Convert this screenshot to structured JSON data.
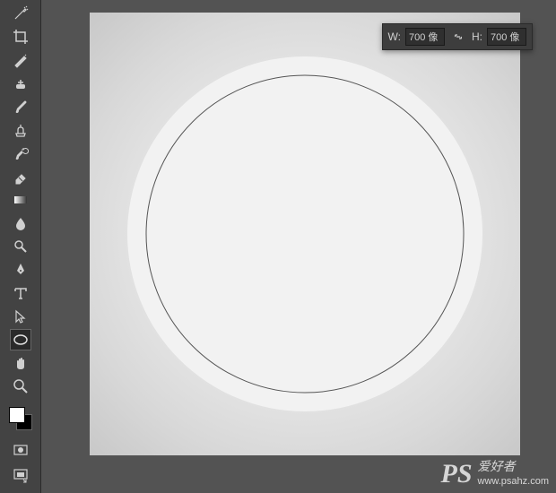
{
  "transform": {
    "width_label": "W:",
    "width_value": "700 像",
    "height_label": "H:",
    "height_value": "700 像"
  },
  "tools": {
    "magic_wand": "magic-wand",
    "crop": "crop",
    "eyedropper": "eyedropper",
    "healing": "healing-brush",
    "brush": "brush",
    "clone": "clone-stamp",
    "history_brush": "history-brush",
    "eraser": "eraser",
    "gradient": "gradient",
    "blur": "blur",
    "dodge": "dodge",
    "pen": "pen",
    "type": "type",
    "path_select": "path-selection",
    "ellipse": "ellipse",
    "hand": "hand",
    "zoom": "zoom",
    "quick_mask": "quick-mask",
    "screen_mode": "screen-mode"
  },
  "watermark": {
    "logo": "PS",
    "cn": "爱好者",
    "url": "www.psahz.com"
  }
}
